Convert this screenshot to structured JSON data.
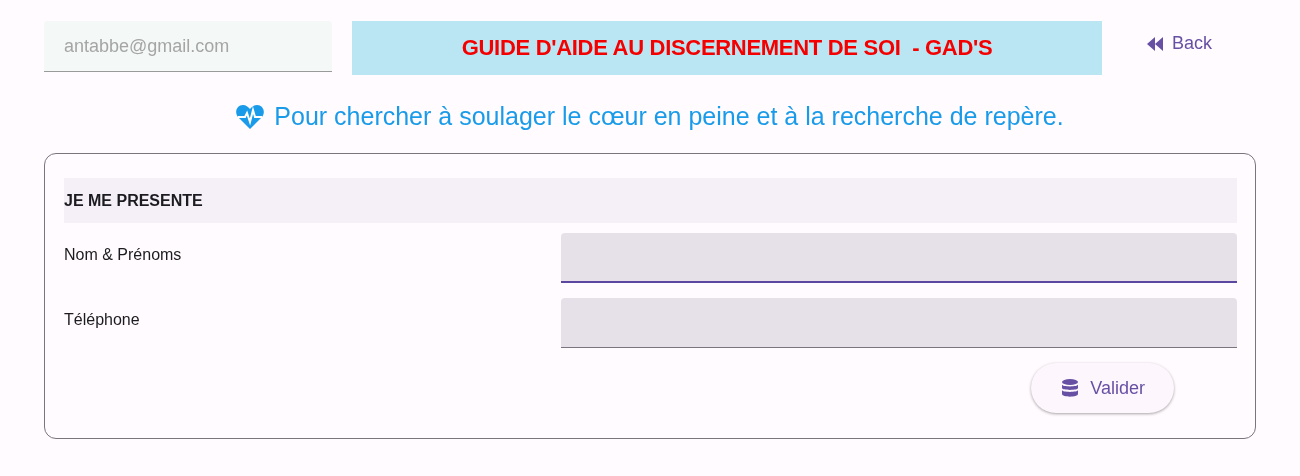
{
  "header": {
    "email_field": {
      "value": "antabbe@gmail.com",
      "disabled": true
    },
    "title": "GUIDE D'AIDE AU DISCERNEMENT DE SOI  - GAD'S",
    "back_link": "Back"
  },
  "subtitle": "Pour chercher à soulager le cœur en peine et à la recherche de repère.",
  "form": {
    "section_title": "JE ME PRESENTE",
    "fields": [
      {
        "label": "Nom & Prénoms",
        "focused": true
      },
      {
        "label": "Téléphone",
        "focused": false
      }
    ],
    "submit_button": "Valider"
  }
}
